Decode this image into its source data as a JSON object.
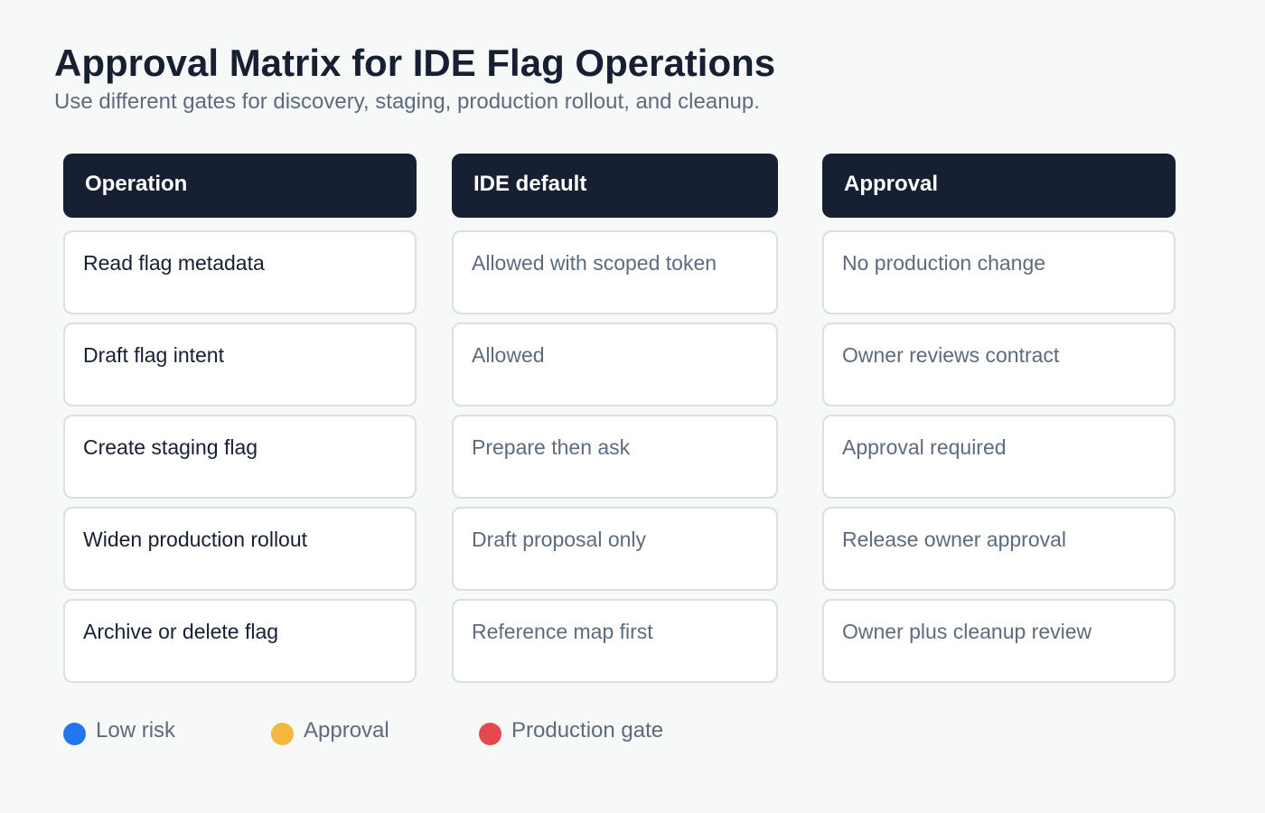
{
  "title": "Approval Matrix for IDE Flag Operations",
  "subtitle": "Use different gates for discovery, staging, production rollout, and cleanup.",
  "columns": [
    {
      "header": "Operation",
      "cells": [
        "Read flag metadata",
        "Draft flag intent",
        "Create staging flag",
        "Widen production rollout",
        "Archive or delete flag"
      ]
    },
    {
      "header": "IDE default",
      "cells": [
        "Allowed with scoped token",
        "Allowed",
        "Prepare then ask",
        "Draft proposal only",
        "Reference map first"
      ]
    },
    {
      "header": "Approval",
      "cells": [
        "No production change",
        "Owner reviews contract",
        "Approval required",
        "Release owner approval",
        "Owner plus cleanup review"
      ]
    }
  ],
  "legend": [
    {
      "label": "Low risk",
      "color": "#2176ee"
    },
    {
      "label": "Approval",
      "color": "#f4b740"
    },
    {
      "label": "Production gate",
      "color": "#e5484d"
    }
  ]
}
